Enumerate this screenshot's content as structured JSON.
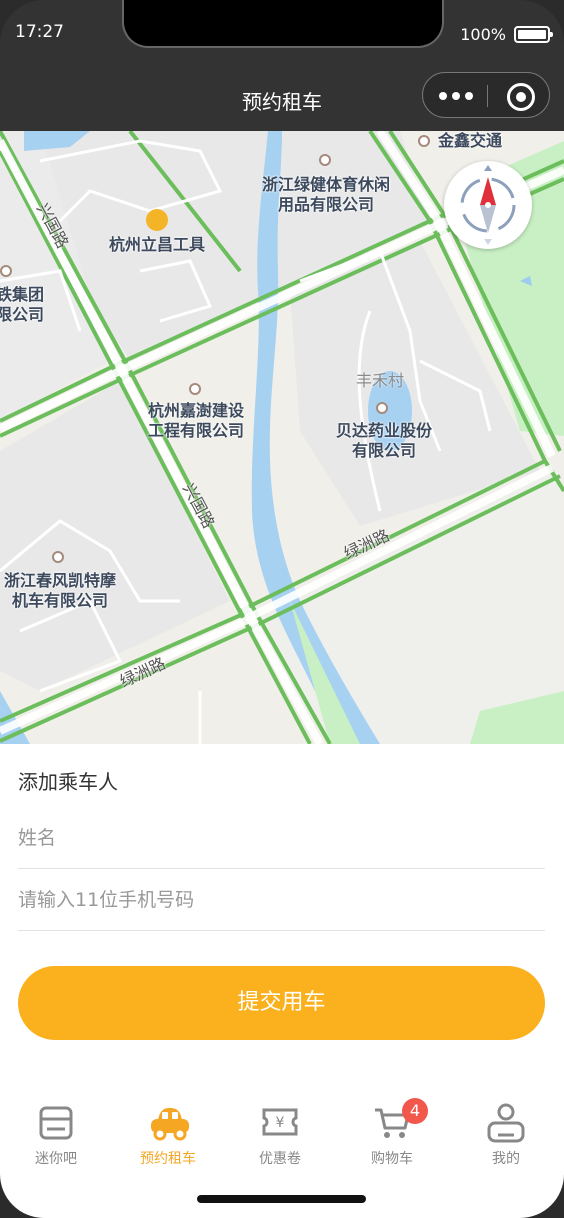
{
  "status": {
    "time": "17:27",
    "battery": "100%"
  },
  "nav": {
    "title": "预约租车"
  },
  "map": {
    "pois": [
      {
        "id": "jinxin",
        "name": "金鑫交通"
      },
      {
        "id": "lvjian",
        "name": "浙江绿健体育休闲\n用品有限公司"
      },
      {
        "id": "lichang",
        "name": "杭州立昌工具"
      },
      {
        "id": "jituan",
        "name": "铁集团\n限公司"
      },
      {
        "id": "jiashu",
        "name": "杭州嘉澍建设\n工程有限公司"
      },
      {
        "id": "beida",
        "name": "贝达药业股份\n有限公司"
      },
      {
        "id": "chunfeng",
        "name": "浙江春风凯特摩\n机车有限公司"
      }
    ],
    "place": "丰禾村",
    "roads": {
      "xingguo": "兴国路",
      "lvzhou": "绿洲路"
    }
  },
  "form": {
    "title": "添加乘车人",
    "name_placeholder": "姓名",
    "phone_placeholder": "请输入11位手机号码",
    "submit_label": "提交用车"
  },
  "tabs": [
    {
      "label": "迷你吧",
      "icon": "card-icon",
      "active": false
    },
    {
      "label": "预约租车",
      "icon": "car-icon",
      "active": true
    },
    {
      "label": "优惠卷",
      "icon": "coupon-icon",
      "active": false
    },
    {
      "label": "购物车",
      "icon": "cart-icon",
      "active": false,
      "badge": "4"
    },
    {
      "label": "我的",
      "icon": "user-icon",
      "active": false
    }
  ],
  "colors": {
    "accent": "#fbb11d",
    "tab_active": "#f5a623",
    "badge": "#f2574c"
  }
}
